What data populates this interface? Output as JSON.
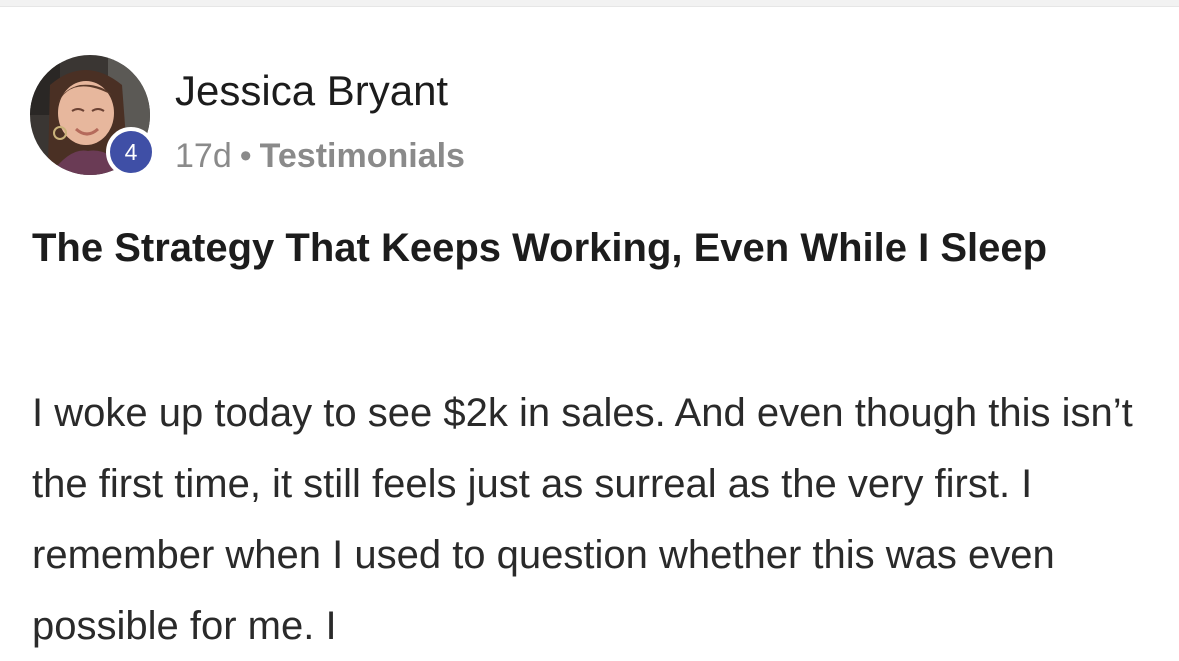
{
  "post": {
    "author": {
      "name": "Jessica Bryant",
      "level": "4",
      "avatar_icon": "user-avatar-photo"
    },
    "meta": {
      "time_ago": "17d",
      "separator": "•",
      "category": "Testimonials"
    },
    "title": "The Strategy That Keeps Working, Even While I Sleep",
    "body": "I woke up today to see $2k in sales. And even though this isn’t the first time, it still feels just as surreal as the very first. I remember when I used to question whether this was even possible for me. I"
  },
  "colors": {
    "badge": "#3f4fa6",
    "meta_text": "#8a8a8a",
    "text": "#1c1c1c"
  }
}
